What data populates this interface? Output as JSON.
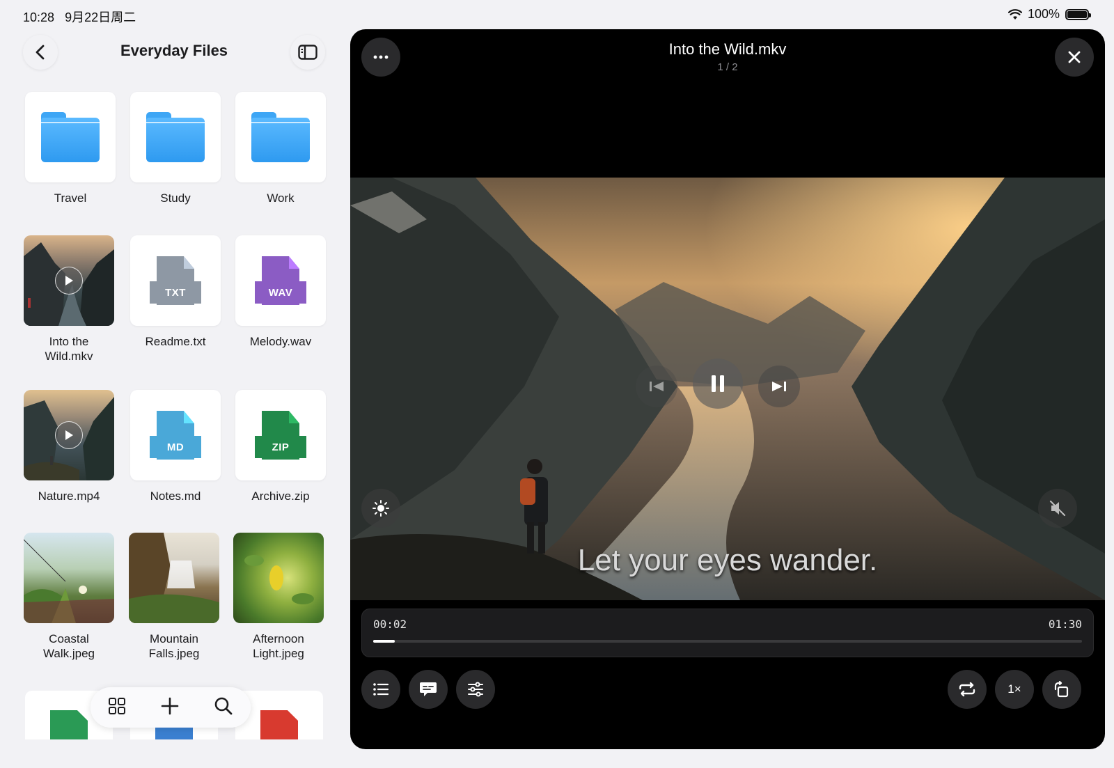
{
  "status_bar": {
    "time": "10:28",
    "date": "9月22日周二",
    "battery_text": "100%"
  },
  "browser": {
    "title": "Everyday Files",
    "items": [
      {
        "label": "Travel",
        "kind": "folder"
      },
      {
        "label": "Study",
        "kind": "folder"
      },
      {
        "label": "Work",
        "kind": "folder"
      },
      {
        "label": "Into the Wild.mkv",
        "kind": "video"
      },
      {
        "label": "Readme.txt",
        "kind": "doc",
        "badge": "TXT",
        "color": "#8e98a4"
      },
      {
        "label": "Melody.wav",
        "kind": "doc",
        "badge": "WAV",
        "color": "#8b5cc4"
      },
      {
        "label": "Nature.mp4",
        "kind": "video"
      },
      {
        "label": "Notes.md",
        "kind": "doc",
        "badge": "MD",
        "color": "#4aa8d8"
      },
      {
        "label": "Archive.zip",
        "kind": "doc",
        "badge": "ZIP",
        "color": "#21894a"
      },
      {
        "label": "Coastal Walk.jpeg",
        "kind": "photo"
      },
      {
        "label": "Mountain Falls.jpeg",
        "kind": "photo"
      },
      {
        "label": "Afternoon Light.jpeg",
        "kind": "photo"
      }
    ],
    "partial_row_colors": [
      "#2a9a55",
      "#3a7fd0",
      "#d83a2f"
    ]
  },
  "player": {
    "title": "Into the Wild.mkv",
    "counter": "1 / 2",
    "subtitle": "Let your eyes wander.",
    "current_time": "00:02",
    "duration": "01:30",
    "progress_fraction": 0.03,
    "speed": "1×"
  }
}
